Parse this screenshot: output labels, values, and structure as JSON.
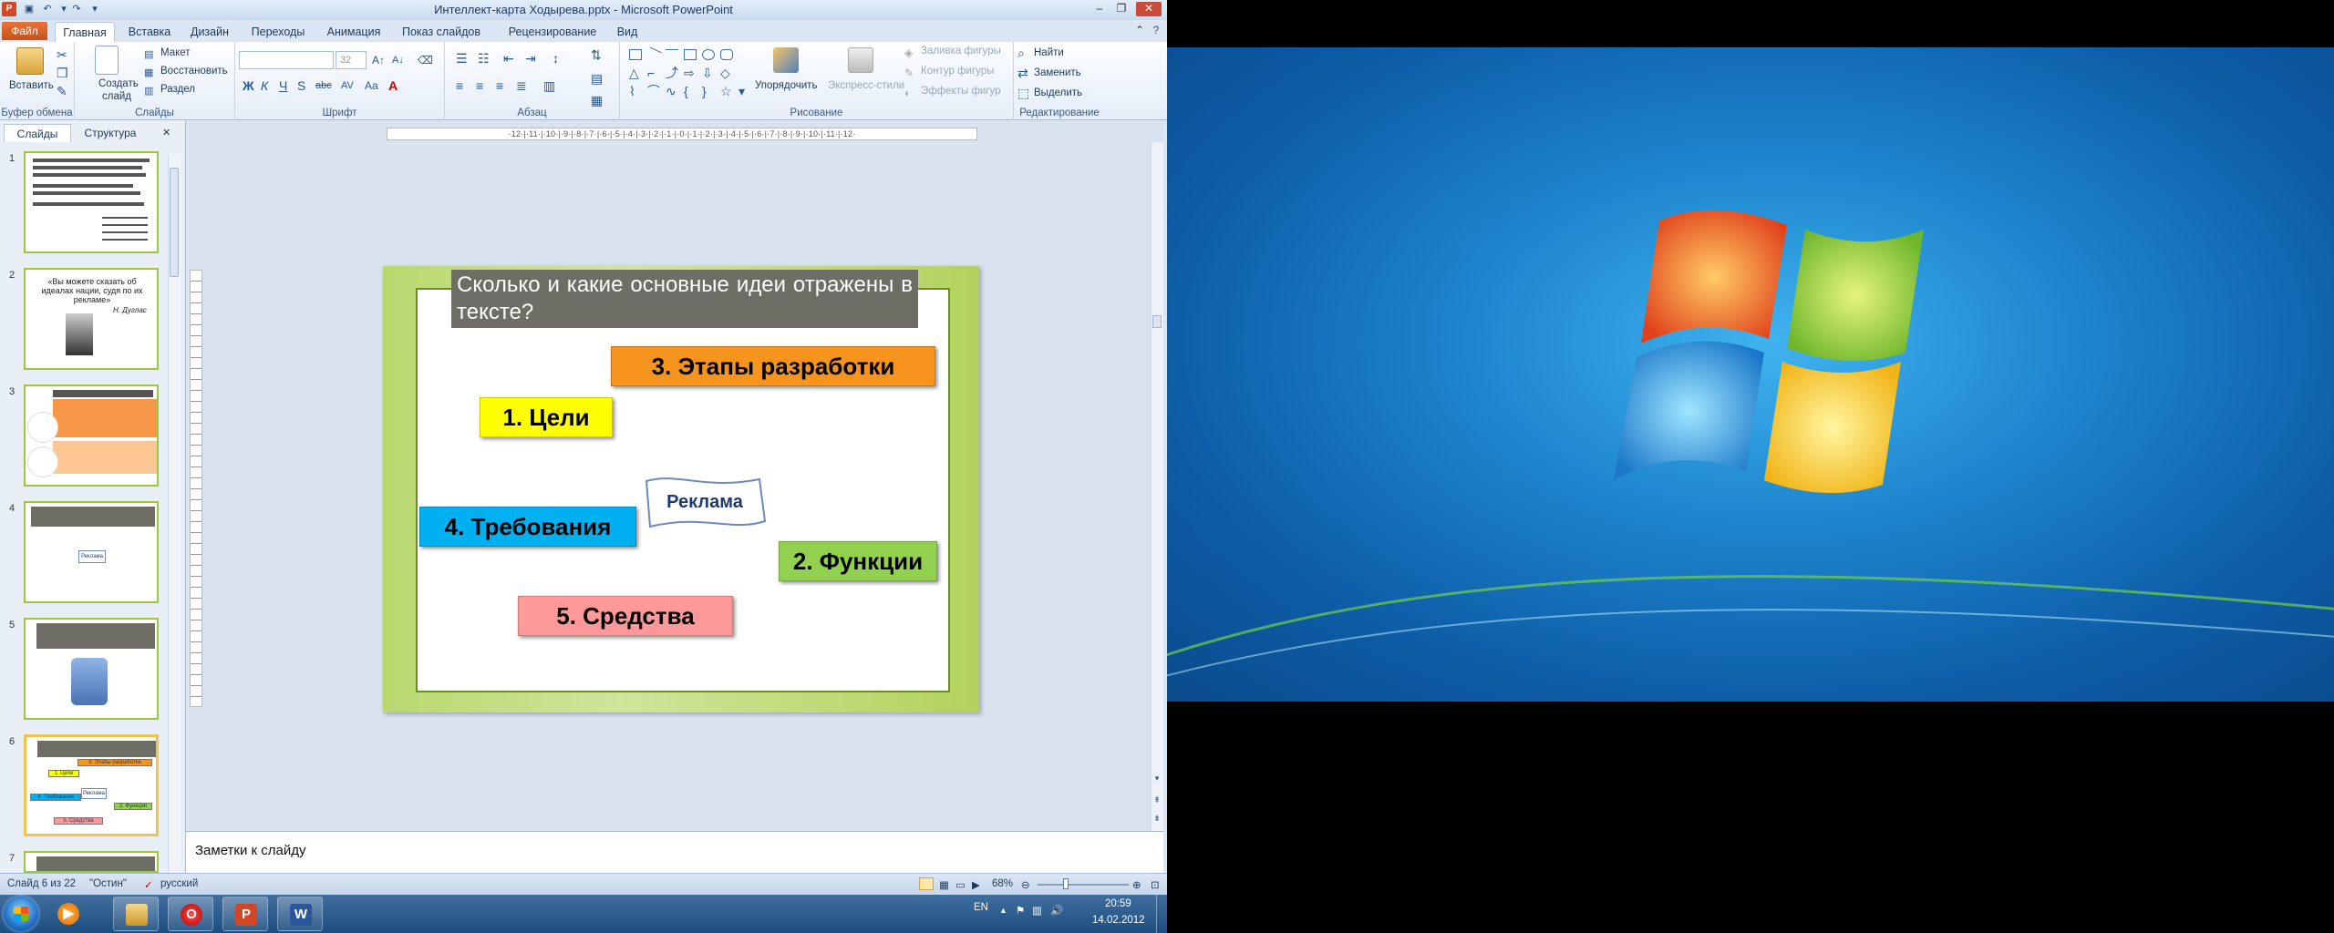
{
  "window": {
    "title": "Интеллект-карта Ходырева.pptx - Microsoft PowerPoint"
  },
  "ribbon": {
    "file_tab": "Файл",
    "tabs": [
      "Главная",
      "Вставка",
      "Дизайн",
      "Переходы",
      "Анимация",
      "Показ слайдов",
      "Рецензирование",
      "Вид"
    ],
    "clipboard": {
      "paste": "Вставить",
      "label": "Буфер обмена"
    },
    "slides": {
      "create": "Создать",
      "create2": "слайд",
      "layout": "Макет",
      "reset": "Восстановить",
      "section": "Раздел",
      "label": "Слайды"
    },
    "font": {
      "size": "32",
      "label": "Шрифт",
      "buttons": [
        "Ж",
        "К",
        "Ч",
        "S",
        "abc",
        "AV",
        "Aa",
        "A"
      ]
    },
    "paragraph": {
      "label": "Абзац"
    },
    "drawing": {
      "arrange": "Упорядочить",
      "quick_styles": "Экспресс-стили",
      "shape_fill": "Заливка фигуры",
      "shape_outline": "Контур фигуры",
      "shape_effects": "Эффекты фигур",
      "label": "Рисование"
    },
    "editing": {
      "find": "Найти",
      "replace": "Заменить",
      "select": "Выделить",
      "label": "Редактирование"
    }
  },
  "panel": {
    "tab_slides": "Слайды",
    "tab_outline": "Структура",
    "close": "✕",
    "slide_numbers": [
      "1",
      "2",
      "3",
      "4",
      "5",
      "6",
      "7"
    ],
    "thumb2_quote": "«Вы можете сказать об идеалах нации, судя по их рекламе»",
    "thumb2_author": "Н. Дуглас",
    "thumb4_label": "Реклама",
    "thumb6_labels": [
      "3. Этапы разработки",
      "1. Цели",
      "4. Требования",
      "Реклама",
      "2. Функции",
      "5. Средства"
    ]
  },
  "ruler": {
    "h": "·12·|·11·|·10·|·9·|·8·|·7·|·6·|·5·|·4·|·3·|·2·|·1·|·0·|·1·|·2·|·3·|·4·|·5·|·6·|·7·|·8·|·9·|·10·|·11·|·12·"
  },
  "slide": {
    "question": "Сколько и какие основные идеи отражены в тексте?",
    "labels": {
      "stages": "3. Этапы разработки",
      "goals": "1. Цели",
      "requirements": "4. Требования",
      "functions": "2. Функции",
      "means": "5. Средства"
    },
    "center": "Реклама",
    "colors": {
      "stages": "#f7941d",
      "goals": "#ffff00",
      "requirements": "#00b0f0",
      "functions": "#92d050",
      "means": "#ff9999",
      "question_bg": "#6e6d66"
    }
  },
  "notes": {
    "placeholder": "Заметки к слайду"
  },
  "status": {
    "slide_info": "Слайд 6 из 22",
    "theme": "\"Остин\"",
    "language": "русский",
    "zoom": "68%"
  },
  "taskbar": {
    "lang": "EN",
    "time": "20:59",
    "date": "14.02.2012"
  }
}
